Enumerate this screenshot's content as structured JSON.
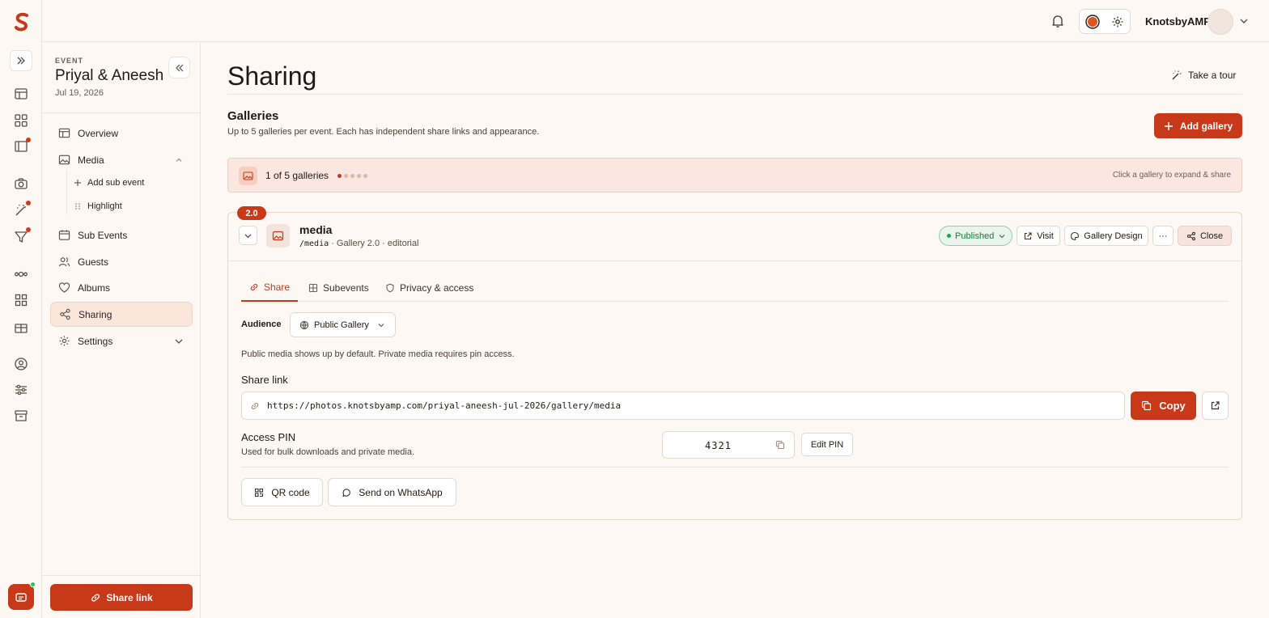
{
  "brand": {
    "accent": "#c8391a",
    "accent_soft": "#fbe7df",
    "success": "#22a04b"
  },
  "topbar": {
    "org_name": "KnotsbyAMP",
    "icons": [
      "bell-icon",
      "theme-swatch-icon",
      "gear-icon",
      "chevron-down-icon"
    ]
  },
  "event": {
    "kicker": "EVENT",
    "title": "Priyal & Aneesh",
    "date": "Jul 19, 2026"
  },
  "sidebar": {
    "items": [
      {
        "label": "Overview",
        "icon": "table-icon"
      },
      {
        "label": "Media",
        "icon": "image-icon"
      },
      {
        "label": "Sub Events",
        "icon": "calendar-icon"
      },
      {
        "label": "Guests",
        "icon": "users-icon"
      },
      {
        "label": "Albums",
        "icon": "heart-icon"
      },
      {
        "label": "Sharing",
        "icon": "share-icon",
        "active": true
      },
      {
        "label": "Settings",
        "icon": "gear-icon"
      }
    ],
    "media_sub": {
      "add_label": "Add sub event",
      "highlight_label": "Highlight"
    },
    "share_link_button": "Share link"
  },
  "page": {
    "title": "Sharing",
    "tour_label": "Take a tour"
  },
  "galleries": {
    "heading": "Galleries",
    "subheading": "Up to 5 galleries per event. Each has independent share links and appearance.",
    "add_button": "Add gallery",
    "count_label": "1 of 5 galleries",
    "count_current": 1,
    "count_max": 5,
    "hint": "Click a gallery to expand & share"
  },
  "gallery": {
    "version_badge": "2.0",
    "name": "media",
    "path": "/media",
    "meta": "· Gallery 2.0 · editorial",
    "status": "Published",
    "visit_label": "Visit",
    "design_label": "Gallery Design",
    "more_label": "···",
    "close_label": "Close",
    "tabs": [
      {
        "label": "Share",
        "icon": "link-icon",
        "active": true
      },
      {
        "label": "Subevents",
        "icon": "grid-icon"
      },
      {
        "label": "Privacy & access",
        "icon": "shield-icon"
      }
    ],
    "audience_label": "Audience",
    "audience_value": "Public Gallery",
    "audience_help": "Public media shows up by default. Private media requires pin access.",
    "share_link_label": "Share link",
    "share_url": "https://photos.knotsbyamp.com/priyal-aneesh-jul-2026/gallery/media",
    "copy_label": "Copy",
    "pin_label": "Access PIN",
    "pin_help": "Used for bulk downloads and private media.",
    "pin_value": "4321",
    "edit_pin_label": "Edit PIN",
    "qr_label": "QR code",
    "whatsapp_label": "Send on WhatsApp"
  }
}
